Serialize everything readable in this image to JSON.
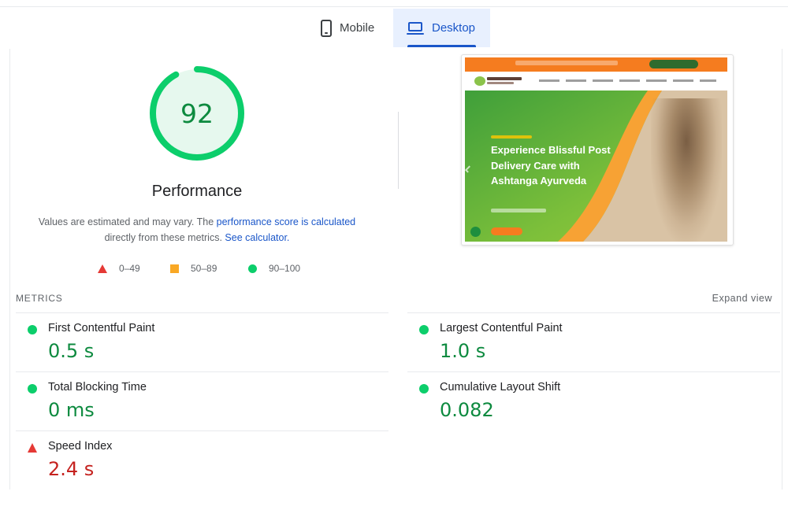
{
  "tabs": [
    {
      "label": "Mobile",
      "icon": "phone-icon",
      "active": false
    },
    {
      "label": "Desktop",
      "icon": "laptop-icon",
      "active": true
    }
  ],
  "score": {
    "value": "92",
    "fraction": 0.92,
    "title": "Performance",
    "color": "#0cce6b"
  },
  "description": {
    "text1": "Values are estimated and may vary. The ",
    "link1": "performance score is calculated",
    "text2": " directly from these metrics. ",
    "link2": "See calculator."
  },
  "legend": [
    {
      "shape": "triangle",
      "label": "0–49",
      "color": "#e53935"
    },
    {
      "shape": "square",
      "label": "50–89",
      "color": "#f9a825"
    },
    {
      "shape": "circle",
      "label": "90–100",
      "color": "#0cce6b"
    }
  ],
  "screenshot": {
    "headline": "Experience Blissful Post Delivery Care with Ashtanga Ayurveda"
  },
  "metrics_header": {
    "label": "METRICS",
    "expand": "Expand view"
  },
  "metrics": [
    {
      "name": "First Contentful Paint",
      "value": "0.5 s",
      "rating": "good"
    },
    {
      "name": "Largest Contentful Paint",
      "value": "1.0 s",
      "rating": "good"
    },
    {
      "name": "Total Blocking Time",
      "value": "0 ms",
      "rating": "good"
    },
    {
      "name": "Cumulative Layout Shift",
      "value": "0.082",
      "rating": "good"
    },
    {
      "name": "Speed Index",
      "value": "2.4 s",
      "rating": "poor"
    }
  ]
}
